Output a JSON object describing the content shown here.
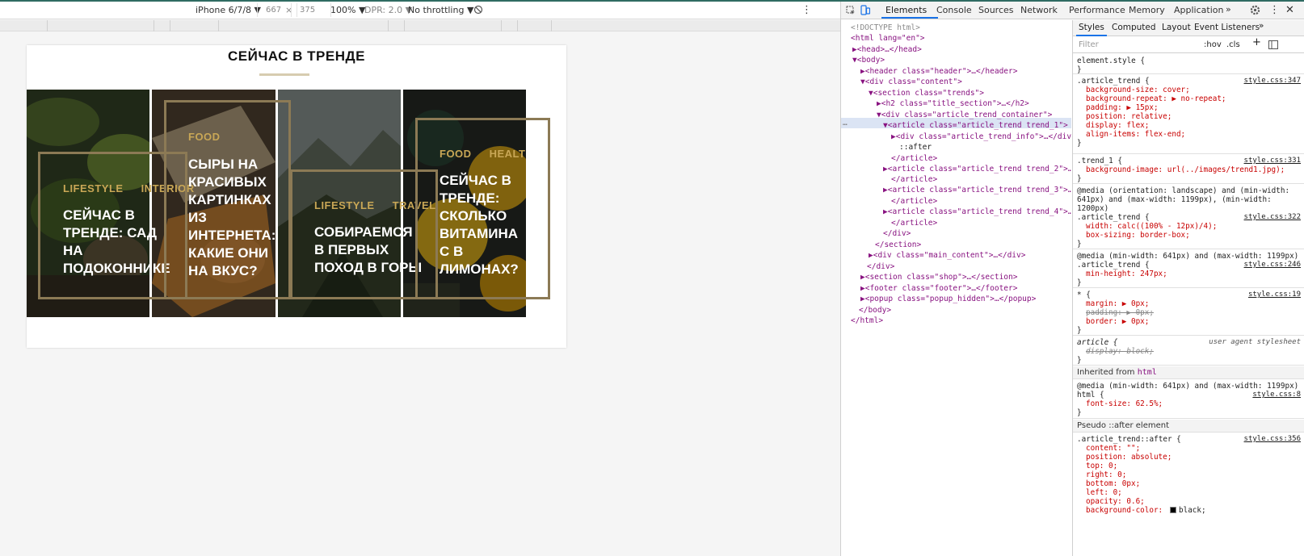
{
  "device_toolbar": {
    "device": "iPhone 6/7/8 ▼",
    "width": "667",
    "x": "×",
    "height": "375",
    "zoom": "100% ▼",
    "dpr": "DPR: 2.0 ▼",
    "throttling": "No throttling ▼",
    "more": "⋮"
  },
  "page": {
    "title": "СЕЙЧАС В ТРЕНДЕ",
    "cards": [
      {
        "tags": [
          "LIFESTYLE",
          "INTERIOR"
        ],
        "lines": [
          "СЕЙЧАС В",
          "ТРЕНДЕ: САД",
          "НА",
          "ПОДОКОННИКЕ"
        ]
      },
      {
        "tags": [
          "FOOD"
        ],
        "lines": [
          "СЫРЫ НА",
          "КРАСИВЫХ",
          "КАРТИНКАХ",
          "ИЗ",
          "ИНТЕРНЕТА:",
          "КАКИЕ ОНИ",
          "НА ВКУС?"
        ]
      },
      {
        "tags": [
          "LIFESTYLE",
          "TRAVEL"
        ],
        "lines": [
          "СОБИРАЕМСЯ",
          "В ПЕРВЫХ",
          "ПОХОД В ГОРЫ"
        ]
      },
      {
        "tags": [
          "FOOD",
          "HEALTH"
        ],
        "lines": [
          "СЕЙЧАС В",
          "ТРЕНДЕ:",
          "СКОЛЬКО",
          "ВИТАМИНА",
          "С В",
          "ЛИМОНАХ?"
        ]
      }
    ]
  },
  "devtools": {
    "tabs": [
      "Elements",
      "Console",
      "Sources",
      "Network",
      "Performance",
      "Memory",
      "Application",
      "»"
    ],
    "dom_lines": [
      "<!DOCTYPE html>",
      "<html lang=\"en\">",
      "▶<head>…</head>",
      "▼<body>",
      "▶<header class=\"header\">…</header>",
      "▼<div class=\"content\">",
      "▼<section class=\"trends\">",
      "▶<h2 class=\"title_section\">…</h2>",
      "▼<div class=\"article_trend_container\">",
      "▼<article class=\"article_trend trend_1\"> == $0",
      "▶<div class=\"article_trend_info\">…</div>",
      "::after",
      "</article>",
      "▶<article class=\"article_trend trend_2\">…",
      "</article>",
      "▶<article class=\"article_trend trend_3\">…",
      "</article>",
      "▶<article class=\"article_trend trend_4\">…",
      "</article>",
      "</div>",
      "</section>",
      "▶<div class=\"main_content\">…</div>",
      "</div>",
      "▶<section class=\"shop\">…</section>",
      "▶<footer class=\"footer\">…</footer>",
      "▶<popup class=\"popup_hidden\">…</popup>",
      "</body>",
      "</html>"
    ],
    "dom_ellipsis": "…",
    "styles_tabs": [
      "Styles",
      "Computed",
      "Layout",
      "Event Listeners",
      "»"
    ],
    "filter_placeholder": "Filter",
    "hov": ":hov",
    "cls": ".cls",
    "plus": "+",
    "rules": [
      {
        "lines": [
          "element.style {",
          "}"
        ]
      },
      {
        "source": "style.css:347",
        "lines": [
          ".article_trend {",
          "background-size: cover;",
          "background-repeat: ▶ no-repeat;",
          "padding: ▶ 15px;",
          "position: relative;",
          "display: flex;",
          "align-items: flex-end;",
          "}"
        ]
      },
      {
        "source": "style.css:331",
        "lines": [
          ".trend_1 {",
          "background-image: url(../images/trend1.jpg);",
          "}"
        ]
      },
      {
        "source": "style.css:322",
        "lines": [
          "@media (orientation: landscape) and (min-width:",
          "641px) and (max-width: 1199px), (min-width:",
          "1200px)",
          ".article_trend {",
          "width: calc((100% - 12px)/4);",
          "box-sizing: border-box;",
          "}"
        ]
      },
      {
        "source": "style.css:246",
        "lines": [
          "@media (min-width: 641px) and (max-width: 1199px)",
          ".article_trend {",
          "min-height: 247px;",
          "}"
        ]
      },
      {
        "source": "style.css:19",
        "lines": [
          "* {",
          "margin: ▶ 0px;",
          "padding: ▶ 0px;",
          "border: ▶ 0px;",
          "}"
        ]
      },
      {
        "source": "user agent stylesheet",
        "lines": [
          "article {",
          "display: block;",
          "}"
        ]
      }
    ],
    "inherited_label": "Inherited from",
    "inherited_tag": "html",
    "inherited_rule": {
      "source": "style.css:8",
      "lines": [
        "@media (min-width: 641px) and (max-width: 1199px)",
        "html {",
        "font-size: 62.5%;",
        "}"
      ]
    },
    "pseudo_label": "Pseudo ::after element",
    "pseudo_rule": {
      "source": "style.css:356",
      "lines": [
        ".article_trend::after {",
        "content: \"\";",
        "position: absolute;",
        "top: 0;",
        "right: 0;",
        "bottom: 0px;",
        "left: 0;",
        "opacity: 0.6;",
        "background-color: ",
        "black;"
      ]
    }
  },
  "colors": {
    "accent_gold": "#c9a756",
    "frame_gold": "#8c7a55",
    "devtools_blue": "#1a73e8",
    "selection": "#dbe4f4"
  }
}
